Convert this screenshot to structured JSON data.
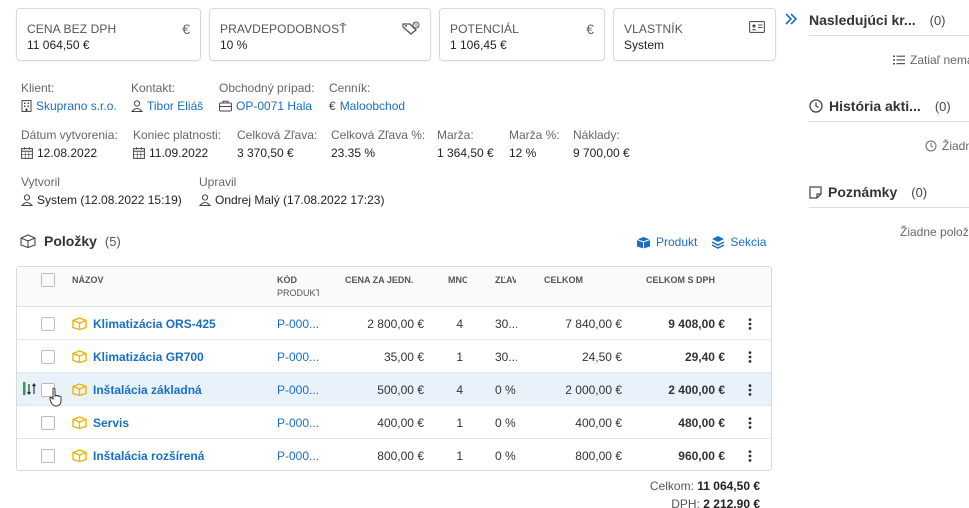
{
  "cards": [
    {
      "label": "CENA BEZ DPH",
      "value": "11 064,50 €",
      "icon": "euro-icon",
      "glyph": "€"
    },
    {
      "label": "PRAVDEPODOBNOSŤ",
      "value": "10 %",
      "icon": "tag-percent-icon"
    },
    {
      "label": "POTENCIÁL",
      "value": "1 106,45 €",
      "icon": "euro-icon",
      "glyph": "€"
    },
    {
      "label": "VLASTNÍK",
      "value": "System",
      "icon": "id-card-icon"
    }
  ],
  "info": {
    "klient": {
      "label": "Klient:",
      "value": "Skuprano s.r.o."
    },
    "kontakt": {
      "label": "Kontakt:",
      "value": "Tibor Eliáš"
    },
    "pripad": {
      "label": "Obchodný prípad:",
      "value": "OP-0071 Hala"
    },
    "cennik": {
      "label": "Cenník:",
      "value": "Maloobchod",
      "glyph": "€"
    },
    "datum": {
      "label": "Dátum vytvorenia:",
      "value": "12.08.2022"
    },
    "koniec": {
      "label": "Koniec platnosti:",
      "value": "11.09.2022"
    },
    "zlava": {
      "label": "Celková Zľava:",
      "value": "3 370,50 €"
    },
    "zlava_pct": {
      "label": "Celková Zľava %:",
      "value": "23.35 %"
    },
    "marza": {
      "label": "Marža:",
      "value": "1 364,50 €"
    },
    "marza_pct": {
      "label": "Marža %:",
      "value": "12 %"
    },
    "naklady": {
      "label": "Náklady:",
      "value": "9 700,00 €"
    },
    "vytvoril": {
      "label": "Vytvoril",
      "value": "System (12.08.2022 15:19)"
    },
    "upravil": {
      "label": "Upravil",
      "value": "Ondrej Malý (17.08.2022 17:23)"
    }
  },
  "items": {
    "title": "Položky",
    "count": "(5)",
    "add_product": "Produkt",
    "add_section": "Sekcia"
  },
  "table": {
    "headers": {
      "name": "NÁZOV",
      "code": "KÓD",
      "code_sub": "PRODUKTU",
      "unit_price": "CENA ZA JEDN.",
      "qty": "MNOŽSTVO",
      "discount": "ZĽAVA",
      "total": "CELKOM",
      "total_vat": "CELKOM S DPH"
    },
    "rows": [
      {
        "name": "Klimatizácia ORS-425",
        "code": "P-000...",
        "unit_price": "2 800,00 €",
        "qty": "4",
        "discount": "30...",
        "total": "7 840,00 €",
        "total_vat": "9 408,00 €"
      },
      {
        "name": "Klimatizácia GR700",
        "code": "P-000...",
        "unit_price": "35,00 €",
        "qty": "1",
        "discount": "30...",
        "total": "24,50 €",
        "total_vat": "29,40 €"
      },
      {
        "name": "Inštalácia základná",
        "code": "P-000...",
        "unit_price": "500,00 €",
        "qty": "4",
        "discount": "0 %",
        "total": "2 000,00 €",
        "total_vat": "2 400,00 €"
      },
      {
        "name": "Servis",
        "code": "P-000...",
        "unit_price": "400,00 €",
        "qty": "1",
        "discount": "0 %",
        "total": "400,00 €",
        "total_vat": "480,00 €"
      },
      {
        "name": "Inštalácia rozšírená",
        "code": "P-000...",
        "unit_price": "800,00 €",
        "qty": "1",
        "discount": "0 %",
        "total": "800,00 €",
        "total_vat": "960,00 €"
      }
    ]
  },
  "totals": {
    "celkom_label": "Celkom:",
    "celkom_value": "11 064,50 €",
    "dph_label": "DPH:",
    "dph_value": "2 212,90 €"
  },
  "right_panel": {
    "next": {
      "title": "Nasledujúci kr...",
      "count": "(0)",
      "empty": "Zatiaľ nema"
    },
    "history": {
      "title": "História akti...",
      "count": "(0)",
      "empty": "Žiadn"
    },
    "notes": {
      "title": "Poznámky",
      "count": "(0)",
      "empty": "Žiadne polož"
    }
  },
  "colors": {
    "link": "#1a6fc0",
    "box_icon": "#f0b400",
    "highlight_row": "#e9f1fb",
    "drag_green": "#2e9e4f"
  }
}
